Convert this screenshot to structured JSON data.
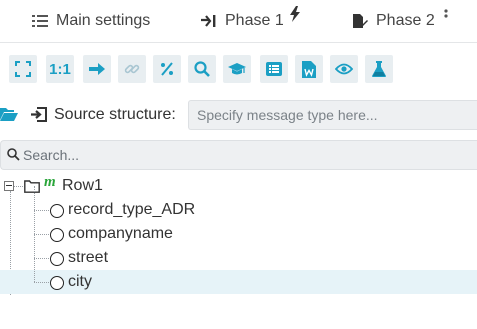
{
  "tabs": {
    "main_settings": "Main settings",
    "phase1": "Phase 1",
    "phase2": "Phase 2"
  },
  "toolbar": {
    "buttons": [
      {
        "name": "fullscreen-icon"
      },
      {
        "name": "one-to-one",
        "label": "1:1"
      },
      {
        "name": "arrow-right-icon"
      },
      {
        "name": "link-icon"
      },
      {
        "name": "percent-icon"
      },
      {
        "name": "search-icon"
      },
      {
        "name": "graduation-cap-icon"
      },
      {
        "name": "list-icon"
      },
      {
        "name": "word-document-icon"
      },
      {
        "name": "eye-icon"
      },
      {
        "name": "flask-icon"
      }
    ]
  },
  "source": {
    "label": "Source structure:",
    "placeholder": "Specify message type here..."
  },
  "search": {
    "placeholder": "Search..."
  },
  "tree": {
    "root": {
      "label": "Row1",
      "badge": "m"
    },
    "children": [
      {
        "label": "record_type_ADR"
      },
      {
        "label": "companyname"
      },
      {
        "label": "street"
      },
      {
        "label": "city",
        "selected": true
      }
    ]
  },
  "colors": {
    "accent": "#1b9fc4",
    "toolbar_button_bg": "#e8eef1",
    "selected_row": "#e6f3f8",
    "badge_green": "#2aa53a"
  }
}
